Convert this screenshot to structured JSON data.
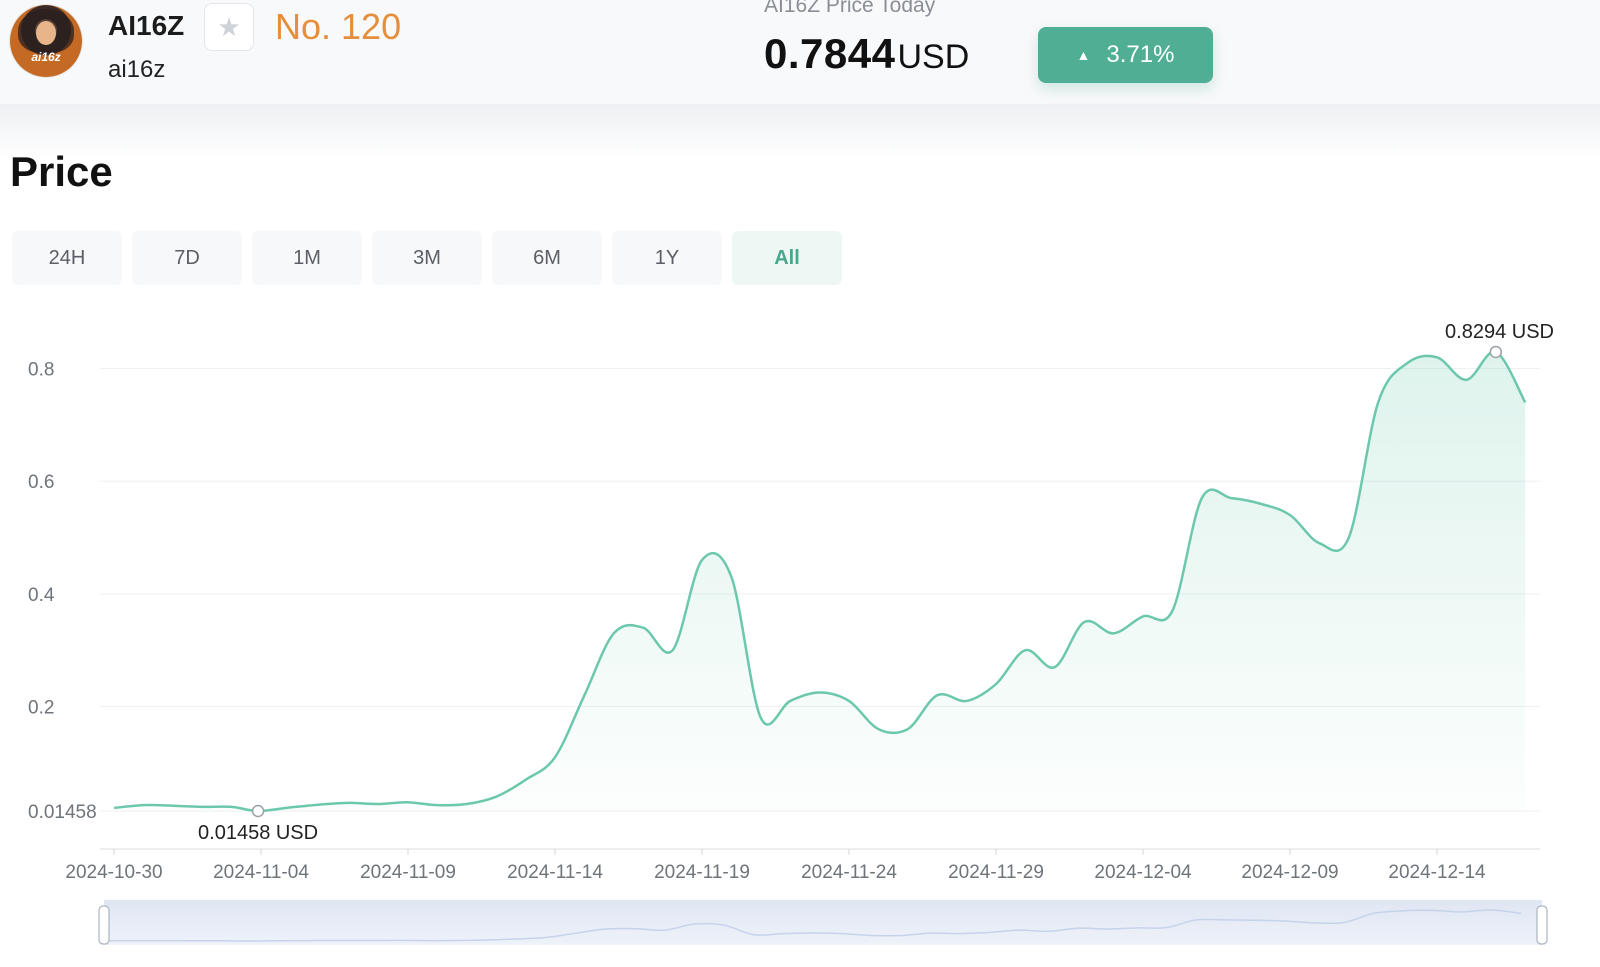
{
  "header": {
    "avatar_text": "ai16z",
    "ticker": "AI16Z",
    "name": "ai16z",
    "rank": "No. 120",
    "price_label": "AI16Z Price Today",
    "price_value": "0.7844",
    "price_unit": "USD",
    "change": "3.71%",
    "change_direction": "up",
    "change_color": "#4fae94",
    "rank_color": "#e58f3c"
  },
  "section": {
    "title": "Price"
  },
  "tabs": [
    {
      "label": "24H",
      "active": false
    },
    {
      "label": "7D",
      "active": false
    },
    {
      "label": "1M",
      "active": false
    },
    {
      "label": "3M",
      "active": false
    },
    {
      "label": "6M",
      "active": false
    },
    {
      "label": "1Y",
      "active": false
    },
    {
      "label": "All",
      "active": true
    }
  ],
  "chart_data": {
    "type": "area",
    "line_color": "#6cc8ac",
    "y_ticks": [
      "0.8",
      "0.6",
      "0.4",
      "0.2",
      "0.01458"
    ],
    "y_tick_values": [
      0.8,
      0.6,
      0.4,
      0.2,
      0.01458
    ],
    "x_ticks": [
      "2024-10-30",
      "2024-11-04",
      "2024-11-09",
      "2024-11-14",
      "2024-11-19",
      "2024-11-24",
      "2024-11-29",
      "2024-12-04",
      "2024-12-09",
      "2024-12-14"
    ],
    "ylim": [
      0.01458,
      0.8294
    ],
    "grid": true,
    "min_label": "0.01458  USD",
    "max_label": "0.8294  USD",
    "min_point": {
      "x": "2024-11-03.9",
      "y": 0.01458
    },
    "max_point": {
      "x": "2024-12-16",
      "y": 0.8294
    },
    "series": [
      {
        "x": [
          "2024-10-30",
          "2024-10-31",
          "2024-11-01",
          "2024-11-02",
          "2024-11-03",
          "2024-11-03.9",
          "2024-11-05",
          "2024-11-06",
          "2024-11-07",
          "2024-11-08",
          "2024-11-09",
          "2024-11-10",
          "2024-11-11",
          "2024-11-12",
          "2024-11-13",
          "2024-11-14",
          "2024-11-15",
          "2024-11-16",
          "2024-11-17",
          "2024-11-18",
          "2024-11-19",
          "2024-11-20",
          "2024-11-21",
          "2024-11-22",
          "2024-11-23",
          "2024-11-24",
          "2024-11-25",
          "2024-11-26",
          "2024-11-27",
          "2024-11-28",
          "2024-11-29",
          "2024-11-30",
          "2024-12-01",
          "2024-12-02",
          "2024-12-03",
          "2024-12-04",
          "2024-12-05",
          "2024-12-06",
          "2024-12-07",
          "2024-12-08",
          "2024-12-09",
          "2024-12-10",
          "2024-12-11",
          "2024-12-12",
          "2024-12-13",
          "2024-12-14",
          "2024-12-15",
          "2024-12-16",
          "2024-12-17"
        ],
        "values": [
          0.02,
          0.025,
          0.024,
          0.022,
          0.022,
          0.01458,
          0.021,
          0.026,
          0.029,
          0.027,
          0.03,
          0.025,
          0.027,
          0.04,
          0.07,
          0.11,
          0.22,
          0.33,
          0.34,
          0.3,
          0.46,
          0.43,
          0.18,
          0.21,
          0.225,
          0.21,
          0.16,
          0.16,
          0.22,
          0.21,
          0.24,
          0.3,
          0.27,
          0.35,
          0.33,
          0.36,
          0.37,
          0.57,
          0.57,
          0.56,
          0.54,
          0.49,
          0.5,
          0.74,
          0.81,
          0.82,
          0.78,
          0.8294,
          0.74
        ]
      }
    ]
  }
}
